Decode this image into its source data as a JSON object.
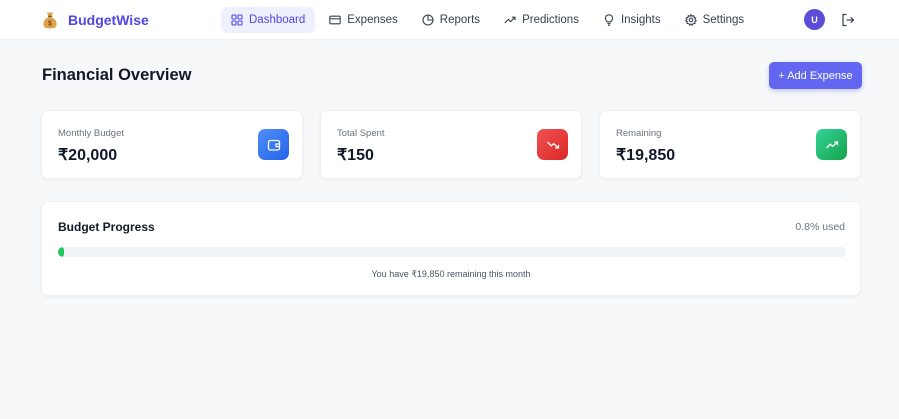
{
  "app": {
    "name": "BudgetWise",
    "logo_icon": "money-bag-icon"
  },
  "nav": {
    "items": [
      {
        "label": "Dashboard",
        "icon": "grid-icon",
        "active": true
      },
      {
        "label": "Expenses",
        "icon": "credit-card-icon",
        "active": false
      },
      {
        "label": "Reports",
        "icon": "pie-chart-icon",
        "active": false
      },
      {
        "label": "Predictions",
        "icon": "trending-up-icon",
        "active": false
      },
      {
        "label": "Insights",
        "icon": "lightbulb-icon",
        "active": false
      },
      {
        "label": "Settings",
        "icon": "gear-icon",
        "active": false
      }
    ],
    "user_initial": "U",
    "logout_icon": "logout-icon"
  },
  "page": {
    "title": "Financial Overview",
    "add_button": "+ Add Expense"
  },
  "stats": [
    {
      "label": "Monthly Budget",
      "value": "₹20,000",
      "icon": "wallet-icon",
      "color": "#3b82f6"
    },
    {
      "label": "Total Spent",
      "value": "₹150",
      "icon": "trending-down-icon",
      "color": "#ef4444"
    },
    {
      "label": "Remaining",
      "value": "₹19,850",
      "icon": "trending-up-icon",
      "color": "#22c55e"
    }
  ],
  "progress": {
    "title": "Budget Progress",
    "used_label": "0.8% used",
    "used_fraction": 0.008,
    "note": "You have ₹19,850 remaining this month"
  },
  "colors": {
    "accent": "#6366f1",
    "brand": "#4f46e5",
    "progress_fill": "#22c55e"
  }
}
